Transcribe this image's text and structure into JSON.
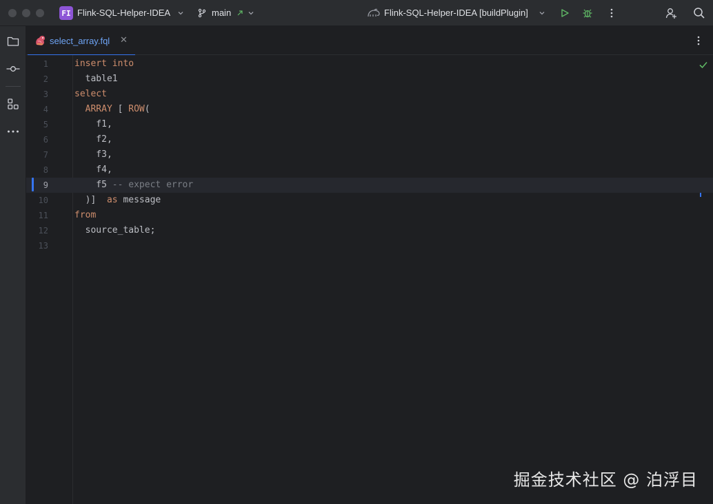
{
  "titlebar": {
    "project_badge": "FI",
    "project_name": "Flink-SQL-Helper-IDEA",
    "branch": "main",
    "run_config": "Flink-SQL-Helper-IDEA [buildPlugin]"
  },
  "tabs": [
    {
      "label": "select_array.fql",
      "active": true
    }
  ],
  "editor": {
    "current_line": 9,
    "lines": [
      {
        "n": "1",
        "tokens": [
          {
            "t": "insert into",
            "c": "kw"
          }
        ]
      },
      {
        "n": "2",
        "tokens": [
          {
            "t": "  table1",
            "c": "id"
          }
        ]
      },
      {
        "n": "3",
        "tokens": [
          {
            "t": "select",
            "c": "kw"
          }
        ]
      },
      {
        "n": "4",
        "tokens": [
          {
            "t": "  ",
            "c": "id"
          },
          {
            "t": "ARRAY",
            "c": "kw"
          },
          {
            "t": " [ ",
            "c": "id"
          },
          {
            "t": "ROW",
            "c": "kw"
          },
          {
            "t": "(",
            "c": "id"
          }
        ]
      },
      {
        "n": "5",
        "tokens": [
          {
            "t": "    f1,",
            "c": "id"
          }
        ]
      },
      {
        "n": "6",
        "tokens": [
          {
            "t": "    f2,",
            "c": "id"
          }
        ]
      },
      {
        "n": "7",
        "tokens": [
          {
            "t": "    f3,",
            "c": "id"
          }
        ]
      },
      {
        "n": "8",
        "tokens": [
          {
            "t": "    f4,",
            "c": "id"
          }
        ]
      },
      {
        "n": "9",
        "tokens": [
          {
            "t": "    f5 ",
            "c": "id"
          },
          {
            "t": "-- expect error",
            "c": "cm"
          }
        ]
      },
      {
        "n": "10",
        "tokens": [
          {
            "t": "  )]  ",
            "c": "id"
          },
          {
            "t": "as",
            "c": "kw"
          },
          {
            "t": " message",
            "c": "id"
          }
        ]
      },
      {
        "n": "11",
        "tokens": [
          {
            "t": "from",
            "c": "kw"
          }
        ]
      },
      {
        "n": "12",
        "tokens": [
          {
            "t": "  source_table;",
            "c": "id"
          }
        ]
      },
      {
        "n": "13",
        "tokens": []
      }
    ]
  },
  "watermark": "掘金技术社区 @ 泊浮目",
  "colors": {
    "keyword": "#cf8e6d",
    "comment": "#7a7e85",
    "identifier": "#bcbec4",
    "accent": "#3574f0",
    "project_badge": "#8d55d6",
    "ok_check": "#5fb865",
    "run": "#5fb865"
  },
  "icons": {
    "branch": "git-branch-icon",
    "run": "run-icon",
    "debug": "debug-icon",
    "more": "more-vertical-icon",
    "add_user": "add-user-icon",
    "search": "search-icon",
    "project": "folder-icon",
    "commit": "commit-icon",
    "structure": "structure-icon",
    "file_type": "flink-squirrel-icon"
  }
}
